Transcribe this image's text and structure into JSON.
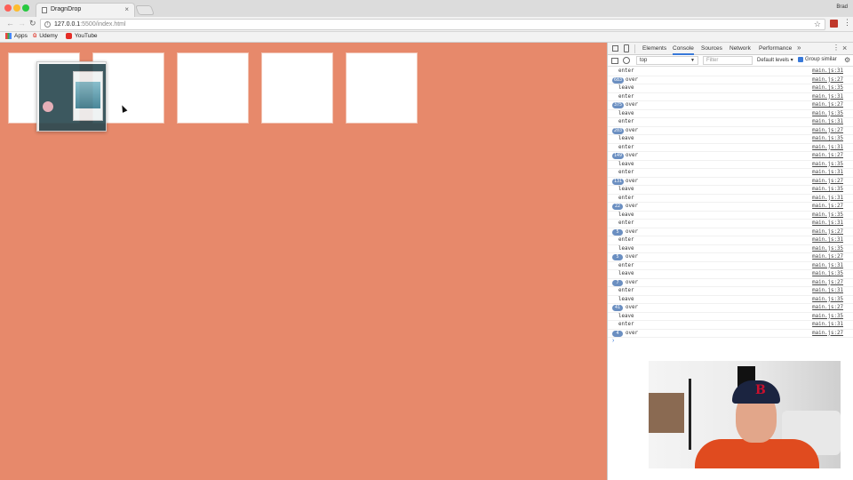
{
  "browser": {
    "tab_title": "DragnDrop",
    "user_name": "Brad",
    "url_host": "127.0.0.1",
    "url_rest": ":5500/index.html",
    "bookmarks": [
      {
        "label": "Apps",
        "icon": "apps-grid-icon"
      },
      {
        "label": "Udemy",
        "icon": "udemy-icon"
      },
      {
        "label": "YouTube",
        "icon": "youtube-icon"
      }
    ]
  },
  "page": {
    "background_color": "#e7896b",
    "box_count": 5
  },
  "devtools": {
    "tabs": [
      "Elements",
      "Console",
      "Sources",
      "Network",
      "Performance"
    ],
    "active_tab": "Console",
    "more_label": "»",
    "context": "top",
    "filter_placeholder": "Filter",
    "levels_label": "Default levels ▾",
    "group_similar_label": "Group similar",
    "logs": [
      {
        "count": "",
        "msg": "enter",
        "src": "main.js:31"
      },
      {
        "count": "683",
        "msg": "over",
        "src": "main.js:27"
      },
      {
        "count": "",
        "msg": "leave",
        "src": "main.js:35"
      },
      {
        "count": "",
        "msg": "enter",
        "src": "main.js:31"
      },
      {
        "count": "375",
        "msg": "over",
        "src": "main.js:27"
      },
      {
        "count": "",
        "msg": "leave",
        "src": "main.js:35"
      },
      {
        "count": "",
        "msg": "enter",
        "src": "main.js:31"
      },
      {
        "count": "203",
        "msg": "over",
        "src": "main.js:27"
      },
      {
        "count": "",
        "msg": "leave",
        "src": "main.js:35"
      },
      {
        "count": "",
        "msg": "enter",
        "src": "main.js:31"
      },
      {
        "count": "149",
        "msg": "over",
        "src": "main.js:27"
      },
      {
        "count": "",
        "msg": "leave",
        "src": "main.js:35"
      },
      {
        "count": "",
        "msg": "enter",
        "src": "main.js:31"
      },
      {
        "count": "131",
        "msg": "over",
        "src": "main.js:27"
      },
      {
        "count": "",
        "msg": "leave",
        "src": "main.js:35"
      },
      {
        "count": "",
        "msg": "enter",
        "src": "main.js:31"
      },
      {
        "count": "22",
        "msg": "over",
        "src": "main.js:27"
      },
      {
        "count": "",
        "msg": "leave",
        "src": "main.js:35"
      },
      {
        "count": "",
        "msg": "enter",
        "src": "main.js:31"
      },
      {
        "count": "5",
        "msg": "over",
        "src": "main.js:27"
      },
      {
        "count": "",
        "msg": "enter",
        "src": "main.js:31"
      },
      {
        "count": "",
        "msg": "leave",
        "src": "main.js:35"
      },
      {
        "count": "5",
        "msg": "over",
        "src": "main.js:27"
      },
      {
        "count": "",
        "msg": "enter",
        "src": "main.js:31"
      },
      {
        "count": "",
        "msg": "leave",
        "src": "main.js:35"
      },
      {
        "count": "7",
        "msg": "over",
        "src": "main.js:27"
      },
      {
        "count": "",
        "msg": "enter",
        "src": "main.js:31"
      },
      {
        "count": "",
        "msg": "leave",
        "src": "main.js:35"
      },
      {
        "count": "41",
        "msg": "over",
        "src": "main.js:27"
      },
      {
        "count": "",
        "msg": "leave",
        "src": "main.js:35"
      },
      {
        "count": "",
        "msg": "enter",
        "src": "main.js:31"
      },
      {
        "count": "4",
        "msg": "over",
        "src": "main.js:27"
      }
    ],
    "prompt": "›"
  }
}
